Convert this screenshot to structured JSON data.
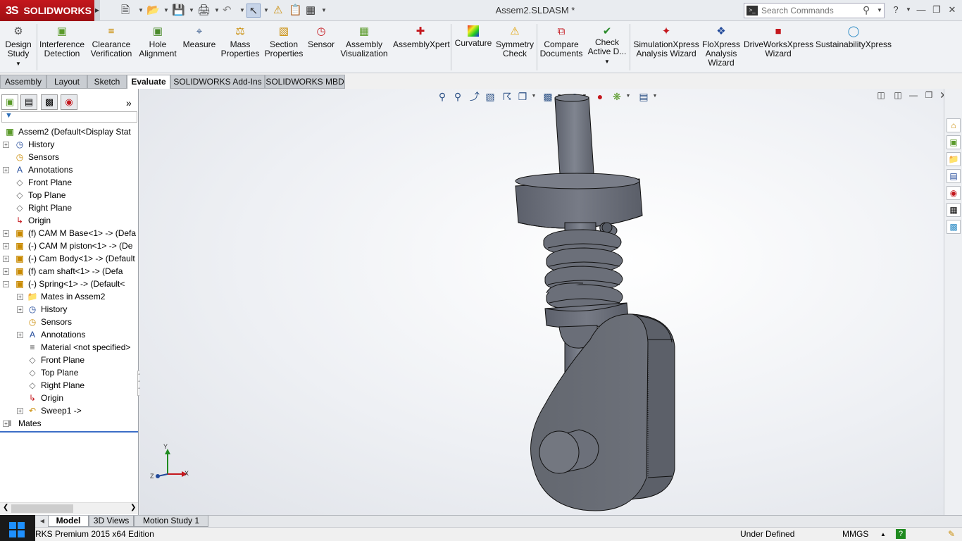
{
  "app": {
    "brand": "SOLIDWORKS",
    "brand_mark": "3S",
    "document_title": "Assem2.SLDASM *"
  },
  "search": {
    "placeholder": "Search Commands",
    "value": ""
  },
  "ribbon": {
    "buttons": [
      {
        "label": [
          "Design",
          "Study"
        ],
        "icon": "design-study-icon",
        "has_dropdown": true
      },
      {
        "label": [
          "Interference",
          "Detection"
        ],
        "icon": "interference-icon"
      },
      {
        "label": [
          "Clearance",
          "Verification"
        ],
        "icon": "clearance-icon"
      },
      {
        "label": [
          "Hole",
          "Alignment"
        ],
        "icon": "hole-alignment-icon"
      },
      {
        "label": [
          "Measure"
        ],
        "icon": "measure-icon"
      },
      {
        "label": [
          "Mass",
          "Properties"
        ],
        "icon": "scale-icon"
      },
      {
        "label": [
          "Section",
          "Properties"
        ],
        "icon": "section-icon"
      },
      {
        "label": [
          "Sensor"
        ],
        "icon": "gauge-icon"
      },
      {
        "label": [
          "Assembly",
          "Visualization"
        ],
        "icon": "assembly-vis-icon"
      },
      {
        "label": [
          "AssemblyXpert"
        ],
        "icon": "assemblyxpert-icon"
      },
      {
        "label": [
          "Curvature"
        ],
        "icon": "curvature-icon"
      },
      {
        "label": [
          "Symmetry",
          "Check"
        ],
        "icon": "warning-icon"
      },
      {
        "label": [
          "Compare",
          "Documents"
        ],
        "icon": "compare-icon"
      },
      {
        "label": [
          "Check",
          "Active D..."
        ],
        "icon": "check-icon",
        "has_dropdown": true
      },
      {
        "label": [
          "SimulationXpress",
          "Analysis Wizard"
        ],
        "icon": "simulation-icon"
      },
      {
        "label": [
          "FloXpress",
          "Analysis",
          "Wizard"
        ],
        "icon": "floxpress-icon"
      },
      {
        "label": [
          "DriveWorksXpress",
          "Wizard"
        ],
        "icon": "driveworks-icon"
      },
      {
        "label": [
          "SustainabilityXpress"
        ],
        "icon": "sustainability-icon"
      }
    ]
  },
  "tabs": [
    {
      "label": "Assembly",
      "active": false
    },
    {
      "label": "Layout",
      "active": false
    },
    {
      "label": "Sketch",
      "active": false
    },
    {
      "label": "Evaluate",
      "active": true
    },
    {
      "label": "SOLIDWORKS Add-Ins",
      "active": false
    },
    {
      "label": "SOLIDWORKS MBD",
      "active": false
    }
  ],
  "tree": [
    {
      "label": "Assem2  (Default<Display Stat",
      "level": 0,
      "icon": "assembly-icon",
      "expander": "none"
    },
    {
      "label": "History",
      "level": 1,
      "icon": "history-icon",
      "expander": "plus"
    },
    {
      "label": "Sensors",
      "level": 1,
      "icon": "sensor-icon",
      "expander": "none"
    },
    {
      "label": "Annotations",
      "level": 1,
      "icon": "annotation-icon",
      "expander": "plus"
    },
    {
      "label": "Front Plane",
      "level": 1,
      "icon": "plane-icon",
      "expander": "none"
    },
    {
      "label": "Top Plane",
      "level": 1,
      "icon": "plane-icon",
      "expander": "none"
    },
    {
      "label": "Right Plane",
      "level": 1,
      "icon": "plane-icon",
      "expander": "none"
    },
    {
      "label": "Origin",
      "level": 1,
      "icon": "origin-icon",
      "expander": "none"
    },
    {
      "label": "(f) CAM M Base<1> -> (Defa",
      "level": 1,
      "icon": "part-icon",
      "expander": "plus"
    },
    {
      "label": "(-) CAM M piston<1> -> (De",
      "level": 1,
      "icon": "part-icon",
      "expander": "plus"
    },
    {
      "label": "(-) Cam Body<1> -> (Default",
      "level": 1,
      "icon": "part-icon",
      "expander": "plus"
    },
    {
      "label": "(f) cam shaft<1> -> (Defa",
      "level": 1,
      "icon": "part-icon",
      "expander": "plus"
    },
    {
      "label": "(-) Spring<1> -> (Default<",
      "level": 1,
      "icon": "part-icon",
      "expander": "minus"
    },
    {
      "label": "Mates in Assem2",
      "level": 2,
      "icon": "mates-folder-icon",
      "expander": "plus"
    },
    {
      "label": "History",
      "level": 2,
      "icon": "history-icon",
      "expander": "plus"
    },
    {
      "label": "Sensors",
      "level": 2,
      "icon": "sensor-icon",
      "expander": "none"
    },
    {
      "label": "Annotations",
      "level": 2,
      "icon": "annotation-icon",
      "expander": "plus"
    },
    {
      "label": "Material <not specified>",
      "level": 2,
      "icon": "material-icon",
      "expander": "none"
    },
    {
      "label": "Front Plane",
      "level": 2,
      "icon": "plane-icon",
      "expander": "none"
    },
    {
      "label": "Top Plane",
      "level": 2,
      "icon": "plane-icon",
      "expander": "none"
    },
    {
      "label": "Right Plane",
      "level": 2,
      "icon": "plane-icon",
      "expander": "none"
    },
    {
      "label": "Origin",
      "level": 2,
      "icon": "origin-icon",
      "expander": "none"
    },
    {
      "label": "Sweep1 ->",
      "level": 2,
      "icon": "sweep-icon",
      "expander": "plus"
    },
    {
      "label": "Mates",
      "level": 0,
      "icon": "mates-icon",
      "expander": "plus"
    }
  ],
  "triad": {
    "x": "X",
    "y": "Y",
    "z": "Z"
  },
  "bottom_tabs": [
    {
      "label": "Model",
      "active": true
    },
    {
      "label": "3D Views",
      "active": false
    },
    {
      "label": "Motion Study 1",
      "active": false
    }
  ],
  "status": {
    "edition": "RKS Premium 2015 x64 Edition",
    "state": "Under Defined",
    "units": "MMGS"
  },
  "colors": {
    "brand_red": "#c4171d",
    "model_gray": "#70747f",
    "accent_blue": "#3c6ec6"
  }
}
